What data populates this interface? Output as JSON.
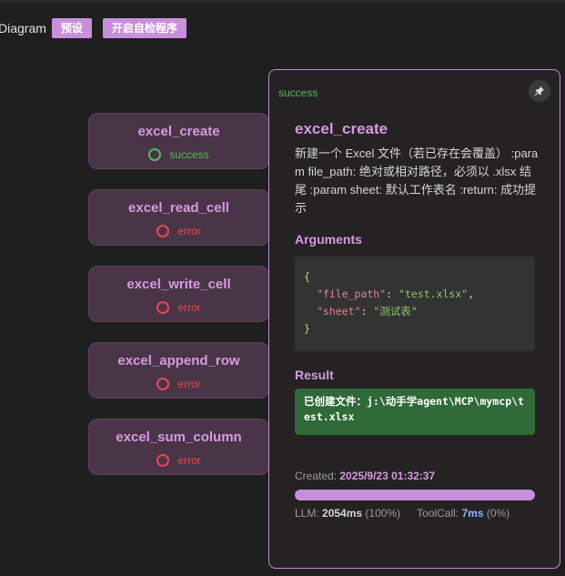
{
  "topbar": {
    "diagram_label": "Diagram",
    "preset_label": "预设",
    "selfcheck_label": "开启自检程序"
  },
  "nodes": [
    {
      "title": "excel_create",
      "status": "success"
    },
    {
      "title": "excel_read_cell",
      "status": "error"
    },
    {
      "title": "excel_write_cell",
      "status": "error"
    },
    {
      "title": "excel_append_row",
      "status": "error"
    },
    {
      "title": "excel_sum_column",
      "status": "error"
    }
  ],
  "panel": {
    "status": "success",
    "title": "excel_create",
    "description": "新建一个 Excel 文件（若已存在会覆盖） :param file_path: 绝对或相对路径，必须以 .xlsx 结尾 :param sheet: 默认工作表名 :return: 成功提示",
    "arguments_heading": "Arguments",
    "args": {
      "open": "{",
      "k1": "\"file_path\"",
      "v1": "\"test.xlsx\"",
      "k2": "\"sheet\"",
      "v2": "\"测试表\"",
      "close": "}"
    },
    "result_heading": "Result",
    "result_text": "已创建文件：j:\\动手学agent\\MCP\\mymcp\\test.xlsx",
    "created_label": "Created:",
    "created_value": "2025/9/23 01:32:37",
    "llm_label": "LLM:",
    "llm_ms": "2054ms",
    "llm_pct": "(100%)",
    "toolcall_label": "ToolCall:",
    "toolcall_ms": "7ms",
    "toolcall_pct": "(0%)",
    "progress_fraction": 1.0
  },
  "colors": {
    "accent": "#c98fdc",
    "success": "#4fbb58",
    "error": "#e8484f",
    "result_bg": "#2f6a38"
  },
  "icons": {
    "pin": "pin-icon",
    "status_ring": "status-ring-icon"
  }
}
